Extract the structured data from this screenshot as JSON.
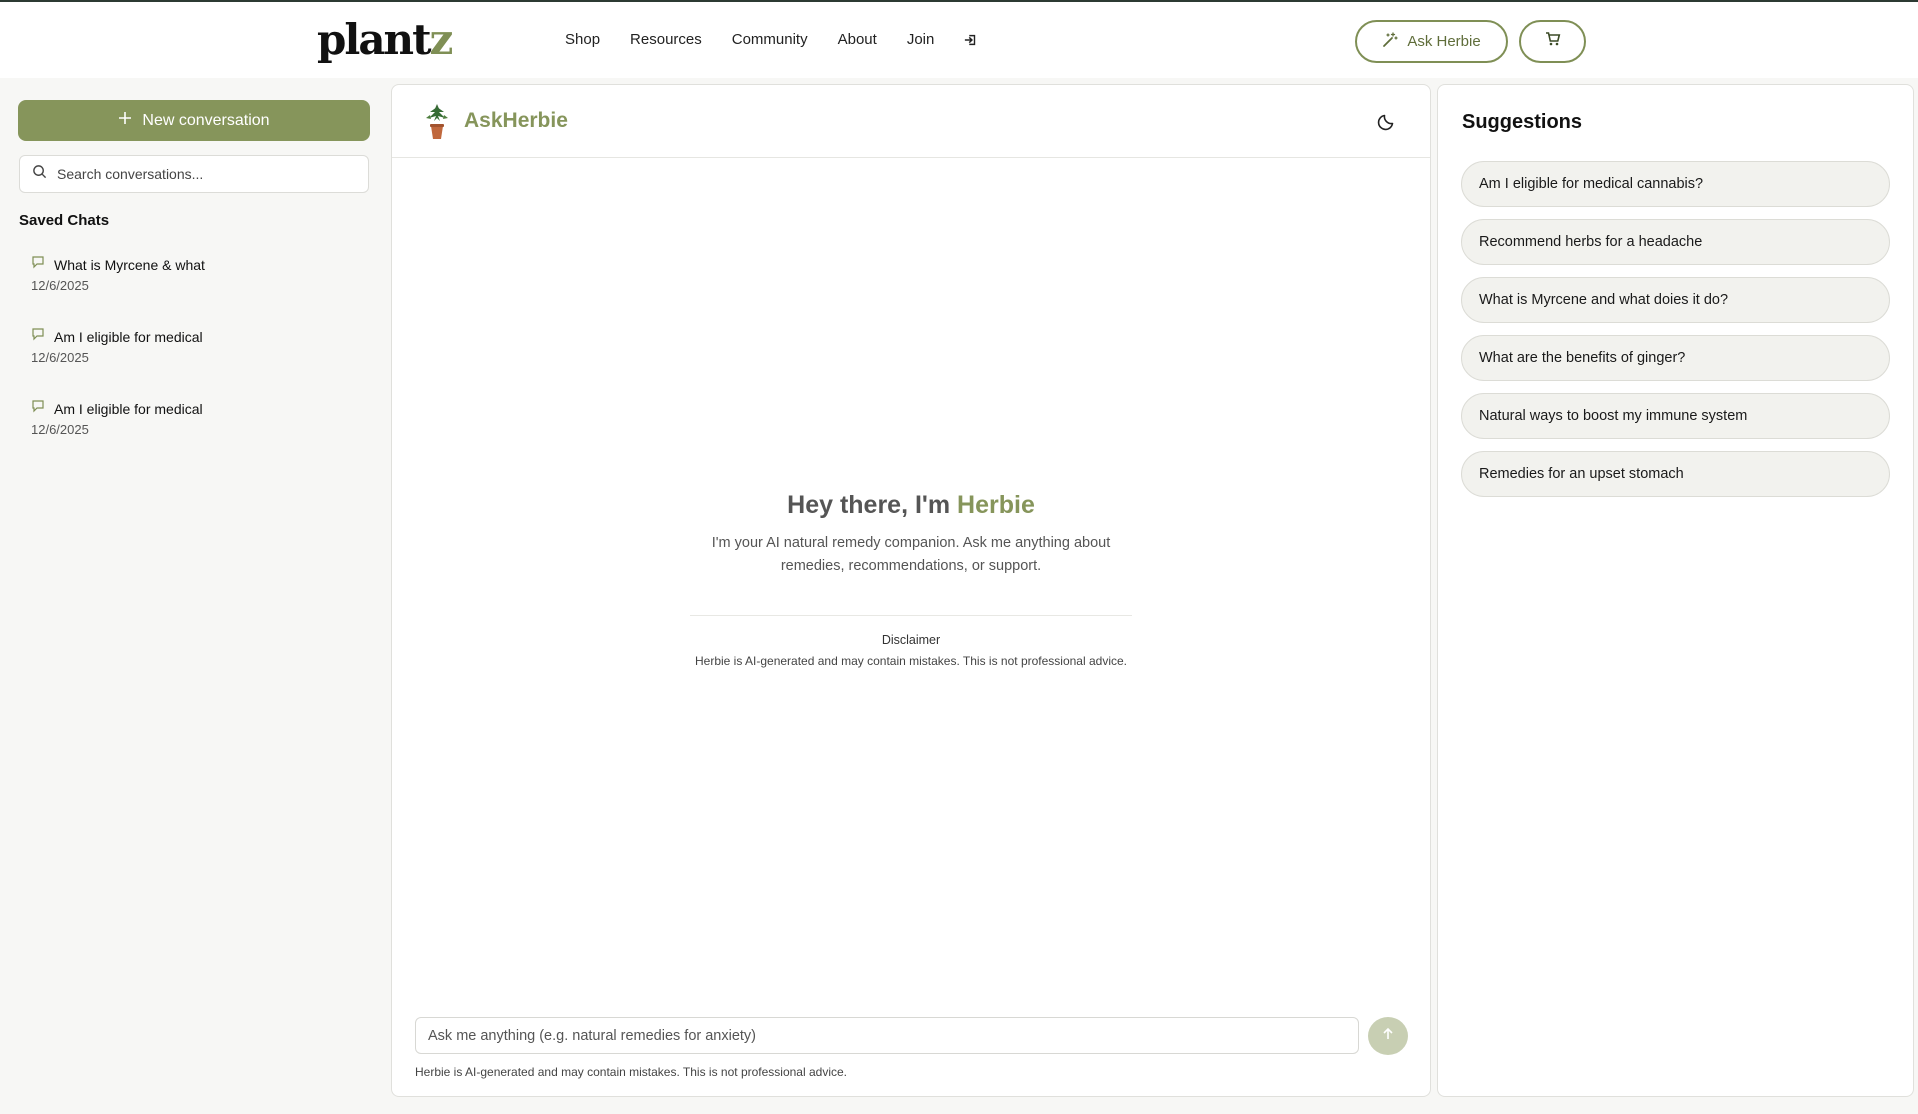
{
  "header": {
    "logo_main": "plant",
    "logo_accent": "z",
    "nav": [
      "Shop",
      "Resources",
      "Community",
      "About",
      "Join"
    ],
    "login_icon": "login-icon",
    "ask_button": "Ask Herbie",
    "cart_icon": "cart-icon"
  },
  "sidebar": {
    "new_conversation": "New conversation",
    "search_placeholder": "Search conversations...",
    "saved_title": "Saved Chats",
    "chats": [
      {
        "title": "What is Myrcene & what",
        "date": "12/6/2025"
      },
      {
        "title": "Am I eligible for medical",
        "date": "12/6/2025"
      },
      {
        "title": "Am I eligible for medical",
        "date": "12/6/2025"
      }
    ]
  },
  "main": {
    "title": "AskHerbie",
    "greeting_prefix": "Hey there, I'm ",
    "greeting_name": "Herbie",
    "intro": "I'm your AI natural remedy companion. Ask me anything about remedies, recommendations, or support.",
    "disclaimer_title": "Disclaimer",
    "disclaimer_text": "Herbie is AI-generated and may contain mistakes. This is not professional advice.",
    "input_placeholder": "Ask me anything (e.g. natural remedies for anxiety)",
    "footer_note": "Herbie is AI-generated and may contain mistakes. This is not professional advice."
  },
  "suggestions": {
    "title": "Suggestions",
    "items": [
      "Am I eligible for medical cannabis?",
      "Recommend herbs for a headache",
      "What is Myrcene and what doies it do?",
      "What are the benefits of ginger?",
      "Natural ways to boost my immune system",
      "Remedies for an upset stomach"
    ]
  },
  "colors": {
    "accent": "#86955b",
    "accent_dark": "#5f6d3a",
    "background": "#f7f7f5"
  }
}
